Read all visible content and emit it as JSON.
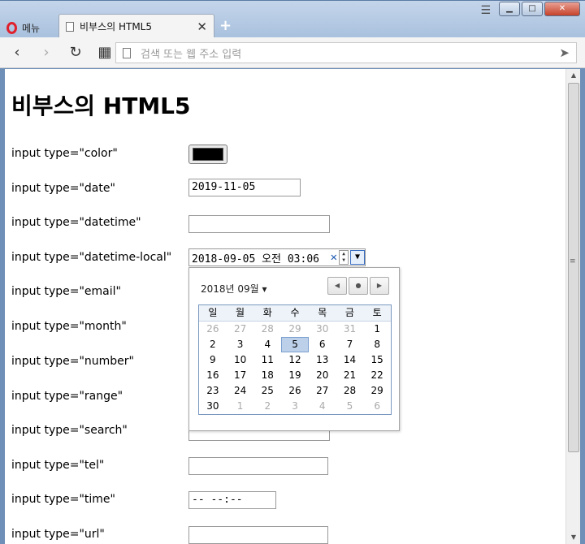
{
  "browser": {
    "menu_label": "메뉴",
    "tab_title": "비부스의 HTML5",
    "tab_close": "✕",
    "new_tab": "+",
    "address_placeholder": "검색 또는 웹 주소 입력"
  },
  "page": {
    "heading": "비부스의 HTML5",
    "rows": [
      {
        "label": "input type=\"color\""
      },
      {
        "label": "input type=\"date\"",
        "value": "2019-11-05"
      },
      {
        "label": "input type=\"datetime\"",
        "value": ""
      },
      {
        "label": "input type=\"datetime-local\"",
        "value": "2018-09-05 오전 03:06"
      },
      {
        "label": "input type=\"email\""
      },
      {
        "label": "input type=\"month\""
      },
      {
        "label": "input type=\"number\""
      },
      {
        "label": "input type=\"range\""
      },
      {
        "label": "input type=\"search\"",
        "value": ""
      },
      {
        "label": "input type=\"tel\"",
        "value": ""
      },
      {
        "label": "input type=\"time\"",
        "value": "-- --:--"
      },
      {
        "label": "input type=\"url\"",
        "value": ""
      }
    ],
    "color_value": "#000000"
  },
  "calendar": {
    "month_label": "2018년 09월 ▾",
    "weekdays": [
      "일",
      "월",
      "화",
      "수",
      "목",
      "금",
      "토"
    ],
    "weeks": [
      [
        "26",
        "27",
        "28",
        "29",
        "30",
        "31",
        "1"
      ],
      [
        "2",
        "3",
        "4",
        "5",
        "6",
        "7",
        "8"
      ],
      [
        "9",
        "10",
        "11",
        "12",
        "13",
        "14",
        "15"
      ],
      [
        "16",
        "17",
        "18",
        "19",
        "20",
        "21",
        "22"
      ],
      [
        "23",
        "24",
        "25",
        "26",
        "27",
        "28",
        "29"
      ],
      [
        "30",
        "1",
        "2",
        "3",
        "4",
        "5",
        "6"
      ]
    ],
    "selected_day": "5"
  }
}
